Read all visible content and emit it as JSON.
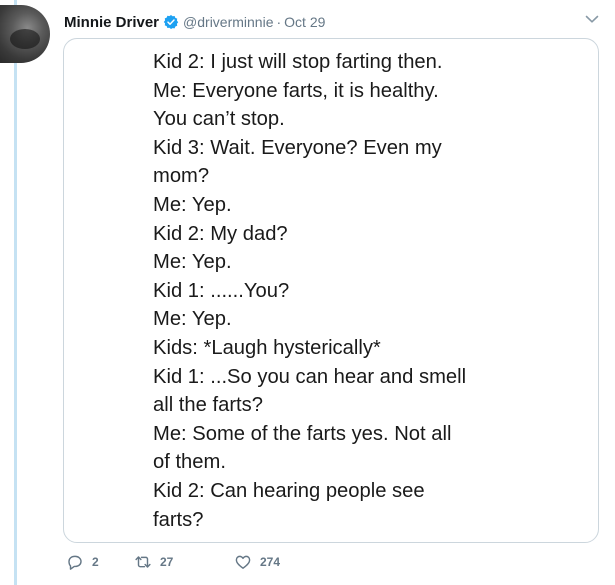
{
  "tweet": {
    "author_name": "Minnie Driver",
    "handle": "@driverminnie",
    "separator": "·",
    "date": "Oct 29",
    "verified": true,
    "media_lines": [
      "Kid 2: I just will stop farting then.",
      "Me: Everyone farts, it is healthy.",
      "You can’t stop.",
      "Kid 3: Wait. Everyone? Even my",
      "mom?",
      "Me: Yep.",
      "Kid 2: My dad?",
      "Me: Yep.",
      "Kid 1: ......You?",
      "Me: Yep.",
      "Kids: *Laugh hysterically*",
      "Kid 1: ...So you can hear and smell",
      "all the farts?",
      "Me: Some of the farts yes. Not all",
      "of them.",
      "Kid 2: Can hearing people see",
      "farts?"
    ],
    "actions": {
      "reply_count": "2",
      "retweet_count": "27",
      "like_count": "274"
    }
  },
  "colors": {
    "verified_badge": "#1da1f2",
    "thread_line": "#c5e2f3",
    "secondary_text": "#657786",
    "card_border": "#ccd6dd"
  },
  "icons": {
    "verified": "verified-badge-icon",
    "caret": "chevron-down-icon",
    "reply": "reply-bubble-icon",
    "retweet": "retweet-arrows-icon",
    "like": "heart-icon"
  }
}
